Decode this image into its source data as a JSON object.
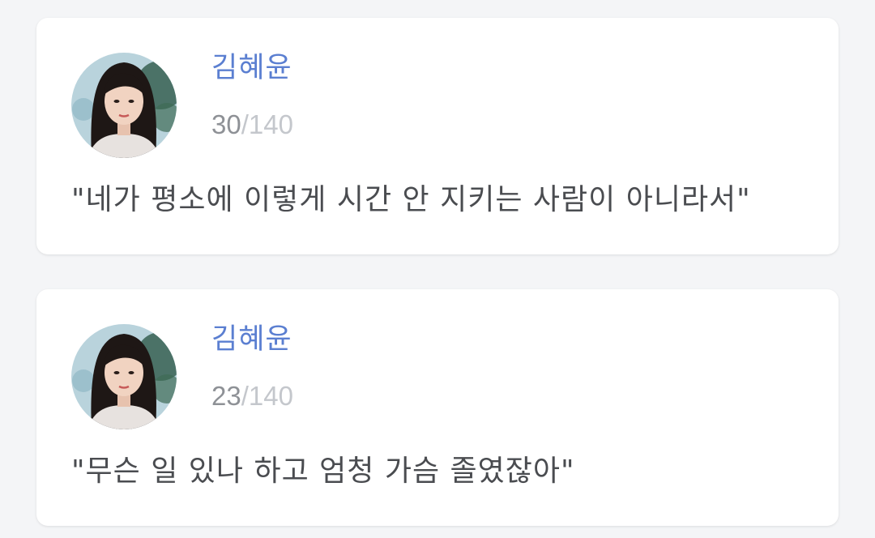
{
  "colors": {
    "background": "#f4f5f7",
    "card": "#ffffff",
    "name": "#5b7fd1",
    "count_current": "#8e9196",
    "count_max": "#c4c7cc",
    "quote_text": "#4a4c50"
  },
  "cards": [
    {
      "author": "김혜윤",
      "avatar_icon": "profile-photo",
      "char_count": "30",
      "char_max": "/140",
      "quote": "\"네가 평소에 이렇게 시간 안 지키는 사람이 아니라서\""
    },
    {
      "author": "김혜윤",
      "avatar_icon": "profile-photo",
      "char_count": "23",
      "char_max": "/140",
      "quote": "\"무슨 일 있나 하고 엄청 가슴 졸였잖아\""
    }
  ]
}
